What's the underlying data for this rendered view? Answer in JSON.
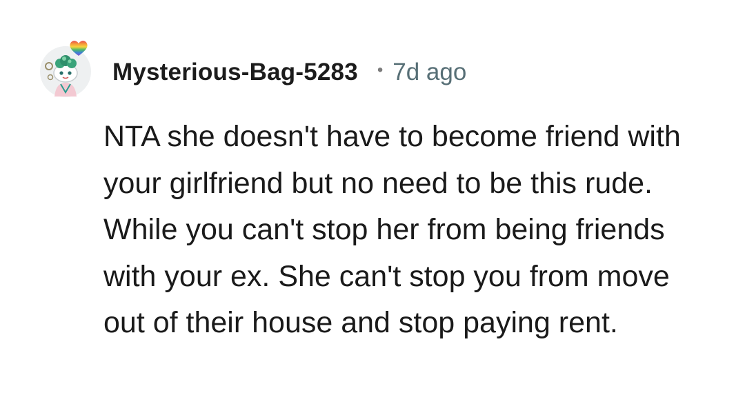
{
  "comment": {
    "username": "Mysterious-Bag-5283",
    "separator": "•",
    "timestamp": "7d ago",
    "body": "NTA she doesn't have to become friend with your girlfriend but no need to be this rude. While you can't stop her from being friends with your ex. She can't stop you from move out of their house and stop paying rent.",
    "avatar_icon": "snoo-avatar-icon",
    "badge_icon": "rainbow-heart-icon"
  },
  "colors": {
    "background": "#ffffff",
    "username": "#1c1c1c",
    "timestamp": "#576f76",
    "body": "#1a1a1a"
  }
}
